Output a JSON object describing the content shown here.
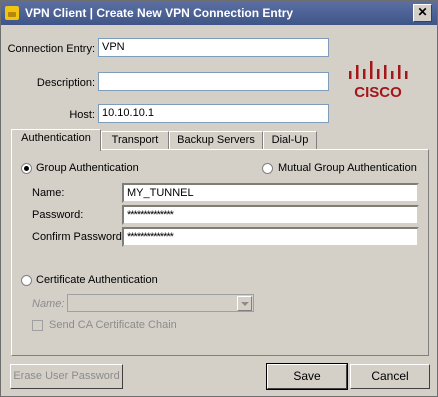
{
  "window": {
    "title": "VPN Client  |  Create New VPN Connection Entry",
    "close_label": "✕"
  },
  "fields": {
    "connection_entry": {
      "label": "Connection Entry:",
      "value": "VPN"
    },
    "description": {
      "label": "Description:",
      "value": ""
    },
    "host": {
      "label": "Host:",
      "value": "10.10.10.1"
    }
  },
  "logo": {
    "text": "CISCO",
    "color": "#a4161a"
  },
  "tabs": [
    {
      "label": "Authentication",
      "active": true
    },
    {
      "label": "Transport"
    },
    {
      "label": "Backup Servers"
    },
    {
      "label": "Dial-Up"
    }
  ],
  "auth": {
    "group_auth_label": "Group Authentication",
    "mutual_auth_label": "Mutual Group Authentication",
    "name_label": "Name:",
    "name_value": "MY_TUNNEL",
    "password_label": "Password:",
    "password_value": "**************",
    "confirm_label": "Confirm Password:",
    "confirm_value": "**************",
    "cert_auth_label": "Certificate Authentication",
    "cert_name_label": "Name:",
    "cert_name_value": "",
    "send_ca_label": "Send CA Certificate Chain"
  },
  "buttons": {
    "erase": "Erase User Password",
    "save": "Save",
    "cancel": "Cancel"
  }
}
